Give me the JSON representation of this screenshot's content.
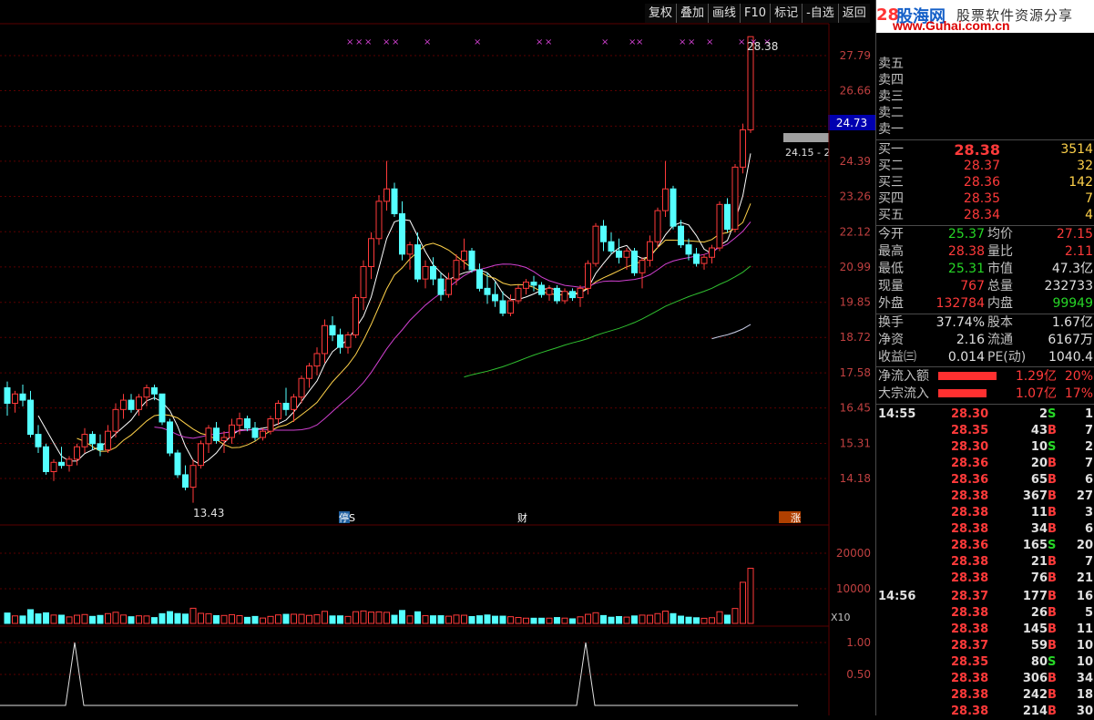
{
  "toolbar": [
    "复权",
    "叠加",
    "画线",
    "F10",
    "标记",
    "-自选",
    "返回"
  ],
  "main_chart": {
    "y_labels": [
      "27.79",
      "26.66",
      "25.52",
      "24.39",
      "23.26",
      "22.12",
      "20.99",
      "19.85",
      "18.72",
      "17.58",
      "16.45",
      "15.31",
      "14.18"
    ],
    "cursor_price": "24.73",
    "high_label": "28.38",
    "low_label": "13.43",
    "range_label": "24.15 - 2",
    "markers": [
      "停S",
      "财",
      "涨"
    ]
  },
  "volume_chart": {
    "y_labels": [
      "20000",
      "10000"
    ],
    "unit": "X10"
  },
  "indicator_chart": {
    "y_labels": [
      "1.00",
      "0.50"
    ]
  },
  "banner": {
    "price_prefix": "28",
    "brand": "股海网",
    "slogan": "股票软件资源分享",
    "url": "www.Guhai.com.cn"
  },
  "sell_book": [
    "卖五",
    "卖四",
    "卖三",
    "卖二",
    "卖一"
  ],
  "buy_book": [
    {
      "label": "买一",
      "price": "28.38",
      "vol": "3514"
    },
    {
      "label": "买二",
      "price": "28.37",
      "vol": "32"
    },
    {
      "label": "买三",
      "price": "28.36",
      "vol": "142"
    },
    {
      "label": "买四",
      "price": "28.35",
      "vol": "7"
    },
    {
      "label": "买五",
      "price": "28.34",
      "vol": "4"
    }
  ],
  "stats": [
    {
      "l1": "今开",
      "v1": "25.37",
      "c1": "grn",
      "l2": "均价",
      "v2": "27.15",
      "c2": "red"
    },
    {
      "l1": "最高",
      "v1": "28.38",
      "c1": "red",
      "l2": "量比",
      "v2": "2.11",
      "c2": "red"
    },
    {
      "l1": "最低",
      "v1": "25.31",
      "c1": "grn",
      "l2": "市值",
      "v2": "47.3亿",
      "c2": "wht"
    },
    {
      "l1": "现量",
      "v1": "767",
      "c1": "red",
      "l2": "总量",
      "v2": "232733",
      "c2": "wht"
    },
    {
      "l1": "外盘",
      "v1": "132784",
      "c1": "red",
      "l2": "内盘",
      "v2": "99949",
      "c2": "grn"
    }
  ],
  "stats2": [
    {
      "l1": "换手",
      "v1": "37.74%",
      "l2": "股本",
      "v2": "1.67亿"
    },
    {
      "l1": "净资",
      "v1": "2.16",
      "l2": "流通",
      "v2": "6167万"
    },
    {
      "l1": "收益㈢",
      "v1": "0.014",
      "l2": "PE(动)",
      "v2": "1040.4"
    }
  ],
  "flows": [
    {
      "label": "净流入额",
      "value": "1.29亿",
      "pct": "20%",
      "fill": 0.85
    },
    {
      "label": "大宗流入",
      "value": "1.07亿",
      "pct": "17%",
      "fill": 0.7
    }
  ],
  "ticks": [
    {
      "time": "14:55",
      "price": "28.30",
      "vol": "2",
      "side": "S",
      "n": "1"
    },
    {
      "time": "",
      "price": "28.35",
      "vol": "43",
      "side": "B",
      "n": "7"
    },
    {
      "time": "",
      "price": "28.30",
      "vol": "10",
      "side": "S",
      "n": "2"
    },
    {
      "time": "",
      "price": "28.36",
      "vol": "20",
      "side": "B",
      "n": "7"
    },
    {
      "time": "",
      "price": "28.36",
      "vol": "65",
      "side": "B",
      "n": "6"
    },
    {
      "time": "",
      "price": "28.38",
      "vol": "367",
      "side": "B",
      "n": "27"
    },
    {
      "time": "",
      "price": "28.38",
      "vol": "11",
      "side": "B",
      "n": "3"
    },
    {
      "time": "",
      "price": "28.38",
      "vol": "34",
      "side": "B",
      "n": "6"
    },
    {
      "time": "",
      "price": "28.36",
      "vol": "165",
      "side": "S",
      "n": "20"
    },
    {
      "time": "",
      "price": "28.38",
      "vol": "21",
      "side": "B",
      "n": "7"
    },
    {
      "time": "",
      "price": "28.38",
      "vol": "76",
      "side": "B",
      "n": "21"
    },
    {
      "time": "14:56",
      "price": "28.37",
      "vol": "177",
      "side": "B",
      "n": "16"
    },
    {
      "time": "",
      "price": "28.38",
      "vol": "26",
      "side": "B",
      "n": "5"
    },
    {
      "time": "",
      "price": "28.38",
      "vol": "145",
      "side": "B",
      "n": "11"
    },
    {
      "time": "",
      "price": "28.37",
      "vol": "59",
      "side": "B",
      "n": "10"
    },
    {
      "time": "",
      "price": "28.35",
      "vol": "80",
      "side": "S",
      "n": "10"
    },
    {
      "time": "",
      "price": "28.38",
      "vol": "306",
      "side": "B",
      "n": "34"
    },
    {
      "time": "",
      "price": "28.38",
      "vol": "242",
      "side": "B",
      "n": "18"
    },
    {
      "time": "",
      "price": "28.38",
      "vol": "214",
      "side": "B",
      "n": "30"
    }
  ],
  "chart_data": {
    "type": "candlestick",
    "candles": [
      [
        17.1,
        17.3,
        16.2,
        16.6
      ],
      [
        16.6,
        17.0,
        16.3,
        16.9
      ],
      [
        16.9,
        17.2,
        16.5,
        16.7
      ],
      [
        16.7,
        17.0,
        15.5,
        15.6
      ],
      [
        15.6,
        15.9,
        15.0,
        15.2
      ],
      [
        15.2,
        15.3,
        14.3,
        14.4
      ],
      [
        14.4,
        14.8,
        14.1,
        14.7
      ],
      [
        14.7,
        15.2,
        14.5,
        14.6
      ],
      [
        14.6,
        14.9,
        14.4,
        14.8
      ],
      [
        14.8,
        15.3,
        14.6,
        15.2
      ],
      [
        15.2,
        15.8,
        15.0,
        15.6
      ],
      [
        15.6,
        15.7,
        15.1,
        15.3
      ],
      [
        15.3,
        15.6,
        14.9,
        15.1
      ],
      [
        15.1,
        15.9,
        15.0,
        15.7
      ],
      [
        15.7,
        16.6,
        15.5,
        16.4
      ],
      [
        16.4,
        16.9,
        16.1,
        16.7
      ],
      [
        16.7,
        16.9,
        16.3,
        16.4
      ],
      [
        16.4,
        16.9,
        16.2,
        16.8
      ],
      [
        16.8,
        17.2,
        16.5,
        17.1
      ],
      [
        17.1,
        17.2,
        16.7,
        16.9
      ],
      [
        16.9,
        16.9,
        15.9,
        16.0
      ],
      [
        16.0,
        16.1,
        14.9,
        15.0
      ],
      [
        15.0,
        15.1,
        14.2,
        14.3
      ],
      [
        14.3,
        14.6,
        13.8,
        13.9
      ],
      [
        13.9,
        14.8,
        13.4,
        14.6
      ],
      [
        14.6,
        15.4,
        14.5,
        15.3
      ],
      [
        15.3,
        15.9,
        15.0,
        15.8
      ],
      [
        15.8,
        16.0,
        15.3,
        15.4
      ],
      [
        15.4,
        15.7,
        15.0,
        15.5
      ],
      [
        15.5,
        16.1,
        15.3,
        15.9
      ],
      [
        15.9,
        16.3,
        15.6,
        16.1
      ],
      [
        16.1,
        16.2,
        15.7,
        15.8
      ],
      [
        15.8,
        16.0,
        15.4,
        15.5
      ],
      [
        15.5,
        15.8,
        15.4,
        15.7
      ],
      [
        15.7,
        16.2,
        15.6,
        16.1
      ],
      [
        16.1,
        16.7,
        15.9,
        16.6
      ],
      [
        16.6,
        17.1,
        16.2,
        16.4
      ],
      [
        16.4,
        16.9,
        16.0,
        16.8
      ],
      [
        16.8,
        17.5,
        16.6,
        17.4
      ],
      [
        17.4,
        17.9,
        17.1,
        17.8
      ],
      [
        17.8,
        18.4,
        17.5,
        18.2
      ],
      [
        18.2,
        19.3,
        17.9,
        19.1
      ],
      [
        19.1,
        19.4,
        18.6,
        18.8
      ],
      [
        18.8,
        19.0,
        18.2,
        18.4
      ],
      [
        18.4,
        18.9,
        18.2,
        18.8
      ],
      [
        18.8,
        20.1,
        18.7,
        20.0
      ],
      [
        20.0,
        21.2,
        19.6,
        21.0
      ],
      [
        21.0,
        22.1,
        20.6,
        21.9
      ],
      [
        21.9,
        23.3,
        21.7,
        23.1
      ],
      [
        23.1,
        24.4,
        22.8,
        23.5
      ],
      [
        23.5,
        23.7,
        22.6,
        22.7
      ],
      [
        22.7,
        23.1,
        21.2,
        21.4
      ],
      [
        21.4,
        21.8,
        20.9,
        21.7
      ],
      [
        21.7,
        22.1,
        20.5,
        20.6
      ],
      [
        20.6,
        21.2,
        20.3,
        21.0
      ],
      [
        21.0,
        21.3,
        20.4,
        20.6
      ],
      [
        20.6,
        20.8,
        19.9,
        20.1
      ],
      [
        20.1,
        20.8,
        20.0,
        20.6
      ],
      [
        20.6,
        21.4,
        20.4,
        21.2
      ],
      [
        21.2,
        21.9,
        20.9,
        21.5
      ],
      [
        21.5,
        21.6,
        20.8,
        20.9
      ],
      [
        20.9,
        21.1,
        20.2,
        20.3
      ],
      [
        20.3,
        20.8,
        19.8,
        20.1
      ],
      [
        20.1,
        20.5,
        19.7,
        19.9
      ],
      [
        19.9,
        20.2,
        19.4,
        19.5
      ],
      [
        19.5,
        20.1,
        19.4,
        19.9
      ],
      [
        19.9,
        20.4,
        19.8,
        20.3
      ],
      [
        20.3,
        20.6,
        20.1,
        20.5
      ],
      [
        20.5,
        20.7,
        20.2,
        20.4
      ],
      [
        20.4,
        20.5,
        20.0,
        20.1
      ],
      [
        20.1,
        20.4,
        19.9,
        20.3
      ],
      [
        20.3,
        20.4,
        19.8,
        19.9
      ],
      [
        19.9,
        20.3,
        19.8,
        20.2
      ],
      [
        20.2,
        20.3,
        19.9,
        20.0
      ],
      [
        20.0,
        20.4,
        19.7,
        20.3
      ],
      [
        20.3,
        21.2,
        20.1,
        21.1
      ],
      [
        21.1,
        22.4,
        21.0,
        22.3
      ],
      [
        22.3,
        22.5,
        21.5,
        21.8
      ],
      [
        21.8,
        22.1,
        21.4,
        21.5
      ],
      [
        21.5,
        21.9,
        21.1,
        21.3
      ],
      [
        21.3,
        21.6,
        20.9,
        21.5
      ],
      [
        21.5,
        21.6,
        20.7,
        20.8
      ],
      [
        20.8,
        21.3,
        20.3,
        21.2
      ],
      [
        21.2,
        22.0,
        21.0,
        21.8
      ],
      [
        21.8,
        22.9,
        21.6,
        22.8
      ],
      [
        22.8,
        24.4,
        22.6,
        23.5
      ],
      [
        23.5,
        23.6,
        22.2,
        22.3
      ],
      [
        22.3,
        22.5,
        21.6,
        21.7
      ],
      [
        21.7,
        21.9,
        21.2,
        21.4
      ],
      [
        21.4,
        21.6,
        21.0,
        21.1
      ],
      [
        21.1,
        21.4,
        20.9,
        21.3
      ],
      [
        21.3,
        21.7,
        21.1,
        21.6
      ],
      [
        21.6,
        23.1,
        21.5,
        23.0
      ],
      [
        23.0,
        23.2,
        22.1,
        22.2
      ],
      [
        22.2,
        24.3,
        22.1,
        24.2
      ],
      [
        24.2,
        25.6,
        24.0,
        25.4
      ],
      [
        25.4,
        28.4,
        25.3,
        28.4
      ]
    ]
  }
}
